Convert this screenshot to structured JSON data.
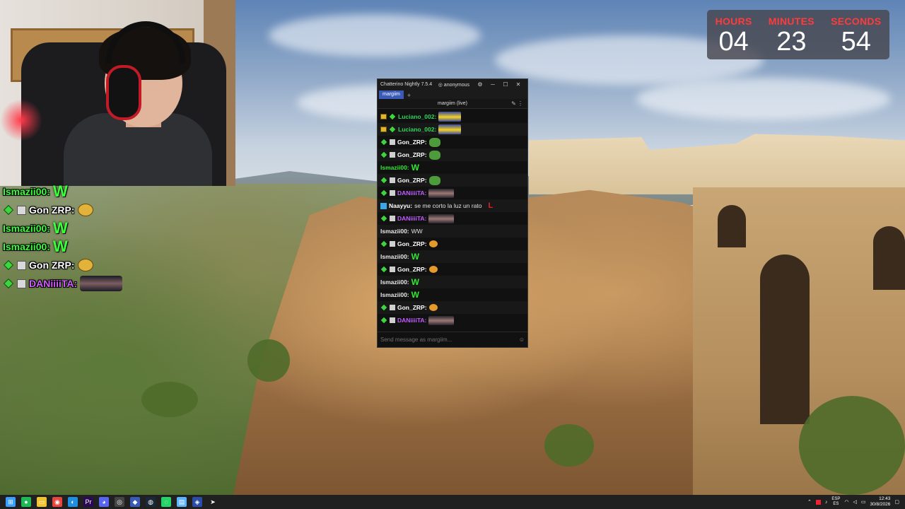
{
  "timer": {
    "hours_label": "HOURS",
    "minutes_label": "MINUTES",
    "seconds_label": "SECONDS",
    "hours": "04",
    "minutes": "23",
    "seconds": "54"
  },
  "overlay_chat": [
    {
      "name": "Ismazii00:",
      "color": "#3cff3c",
      "content": "W",
      "badges": []
    },
    {
      "name": "Gon ZRP:",
      "color": "#ffffff",
      "content": "emote-pepe",
      "badges": [
        "diamond",
        "box"
      ]
    },
    {
      "name": "Ismazii00:",
      "color": "#3cff3c",
      "content": "W",
      "badges": []
    },
    {
      "name": "Ismazii00:",
      "color": "#3cff3c",
      "content": "W",
      "badges": []
    },
    {
      "name": "Gon ZRP:",
      "color": "#ffffff",
      "content": "emote-pepe",
      "badges": [
        "diamond",
        "box"
      ]
    },
    {
      "name": "DANiiiiTA:",
      "color": "#d05cff",
      "content": "emote-dish",
      "badges": [
        "diamond",
        "box"
      ]
    }
  ],
  "chatterino": {
    "title": "Chatterino Nightly 7.5.4",
    "user": "anonymous",
    "tab": "margiim",
    "tab_add": "+",
    "channel_header": "margiim (live)",
    "input_placeholder": "Send message as margiim...",
    "messages": [
      {
        "name": "Luciano_002:",
        "color": "#2fd45a",
        "content": "emote-car",
        "badges": [
          "crown",
          "diamond"
        ]
      },
      {
        "name": "Luciano_002:",
        "color": "#2fd45a",
        "content": "emote-car",
        "badges": [
          "crown",
          "diamond"
        ]
      },
      {
        "name": "Gon_ZRP:",
        "color": "#ffffff",
        "content": "emote-pepe",
        "badges": [
          "diamond",
          "box"
        ]
      },
      {
        "name": "Gon_ZRP:",
        "color": "#ffffff",
        "content": "emote-pepe",
        "badges": [
          "diamond",
          "box"
        ]
      },
      {
        "name": "Ismazii00:",
        "color": "#33e633",
        "content": "W",
        "badges": []
      },
      {
        "name": "Gon_ZRP:",
        "color": "#ffffff",
        "content": "emote-pepe",
        "badges": [
          "diamond",
          "box"
        ]
      },
      {
        "name": "DANiiiiTA:",
        "color": "#c35cff",
        "content": "emote-dish",
        "badges": [
          "diamond",
          "box"
        ]
      },
      {
        "name": "Naayyu:",
        "color": "#ffffff",
        "content": "se me corto la luz un rato",
        "suffix": "L",
        "badges": [
          "blue"
        ]
      },
      {
        "name": "DANiiiiTA:",
        "color": "#c35cff",
        "content": "emote-dish",
        "badges": [
          "diamond",
          "box"
        ]
      },
      {
        "name": "Ismazii00:",
        "color": "#e8e8e8",
        "content": "WW",
        "badges": []
      },
      {
        "name": "Gon_ZRP:",
        "color": "#ffffff",
        "content": "emote-face",
        "badges": [
          "diamond",
          "box"
        ]
      },
      {
        "name": "Ismazii00:",
        "color": "#e8e8e8",
        "content": "W",
        "badges": []
      },
      {
        "name": "Gon_ZRP:",
        "color": "#ffffff",
        "content": "emote-face",
        "badges": [
          "diamond",
          "box"
        ]
      },
      {
        "name": "Ismazii00:",
        "color": "#e8e8e8",
        "content": "W",
        "badges": []
      },
      {
        "name": "Ismazii00:",
        "color": "#e8e8e8",
        "content": "W",
        "badges": []
      },
      {
        "name": "Gon_ZRP:",
        "color": "#ffffff",
        "content": "emote-face",
        "badges": [
          "diamond",
          "box"
        ]
      },
      {
        "name": "DANiiiiTA:",
        "color": "#c35cff",
        "content": "emote-dish",
        "badges": [
          "diamond",
          "box"
        ]
      }
    ]
  },
  "taskbar": {
    "icons": [
      "windows-start-icon",
      "spotify-icon",
      "file-explorer-icon",
      "chrome-icon",
      "edge-icon",
      "premiere-icon",
      "discord-icon",
      "obs-icon",
      "chatterino-icon",
      "steam-icon",
      "whatsapp-icon",
      "notepad-icon",
      "chatterino-alt-icon",
      "cursor-icon"
    ],
    "lang_top": "ESP",
    "lang_bottom": "ES",
    "time": "12:43",
    "date": "30/8/2026"
  },
  "colors": {
    "timer_label": "#ff3b3b",
    "chatterino_tab": "#3a5ab8",
    "taskbar": "#202020"
  }
}
